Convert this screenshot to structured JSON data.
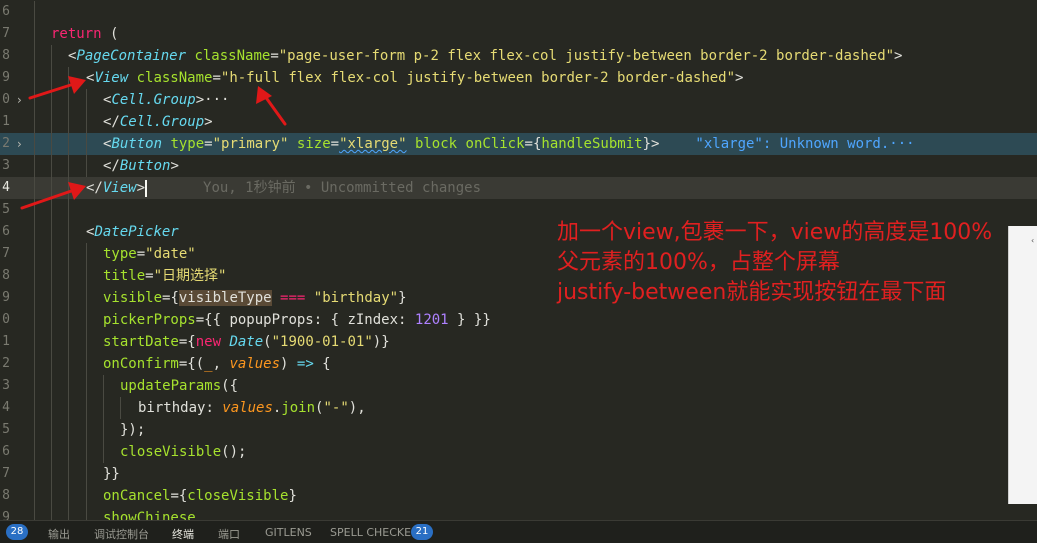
{
  "editor": {
    "line_numbers": [
      "6",
      "7",
      "8",
      "9",
      "0",
      "1",
      "2",
      "3",
      "4",
      "5",
      "6",
      "7",
      "8",
      "9",
      "0",
      "1",
      "2",
      "3",
      "4",
      "5",
      "6",
      "7",
      "8",
      "9",
      "0",
      "1",
      "2",
      "3",
      "4"
    ],
    "fold_marker": "›",
    "return_kw": "return",
    "open_paren": "(",
    "page_container_tag": "PageContainer",
    "attr_classname": "className",
    "page_container_class": "\"page-user-form p-2 flex flex-col justify-between border-2 border-dashed\"",
    "view_tag": "View",
    "view_class": "\"h-full flex flex-col justify-between border-2 border-dashed\"",
    "cell_group_tag": "Cell.Group",
    "ellipsis": "···",
    "button_tag": "Button",
    "attr_type": "type",
    "type_primary": "\"primary\"",
    "attr_size": "size",
    "size_xlarge": "\"xlarge\"",
    "attr_block": "block",
    "attr_onclick": "onClick",
    "handle_submit": "handleSubmit",
    "diagnostic": "\"xlarge\": Unknown word.",
    "blame": "You, 1秒钟前 • Uncommitted changes",
    "datepicker_tag": "DatePicker",
    "type_date": "\"date\"",
    "attr_title": "title",
    "title_value": "\"日期选择\"",
    "attr_visible": "visible",
    "visible_type": "visibleType",
    "triple_eq": "===",
    "birthday_str": "\"birthday\"",
    "attr_picker_props": "pickerProps",
    "popup_props": "popupProps",
    "z_index": "zIndex",
    "z_index_value": "1201",
    "attr_start_date": "startDate",
    "new_kw": "new",
    "date_cls": "Date",
    "date_str": "\"1900-01-01\"",
    "attr_on_confirm": "onConfirm",
    "underscore": "_",
    "values_param": "values",
    "arrow_op": "=>",
    "update_params": "updateParams",
    "birthday_key": "birthday",
    "join_fn": "join",
    "dash_str": "\"-\"",
    "close_visible": "closeVisible",
    "attr_on_cancel": "onCancel",
    "attr_show_chinese": "showChinese"
  },
  "annotation": {
    "line1": "加一个view,包裹一下，view的高度是100%",
    "line2": "父元素的100%，占整个屏幕",
    "line3": "justify-between就能实现按钮在最下面"
  },
  "colors": {
    "annotation": "#e02020",
    "arrow": "#e01818",
    "editor_bg": "#272822"
  },
  "panel": {
    "badge_left": "28",
    "tab_output": "输出",
    "tab_debug_console": "调试控制台",
    "tab_terminal": "终端",
    "tab_ports": "端口",
    "tab_gitlens": "GITLENS",
    "tab_spell_checker": "SPELL CHECKER",
    "spell_badge": "21"
  }
}
